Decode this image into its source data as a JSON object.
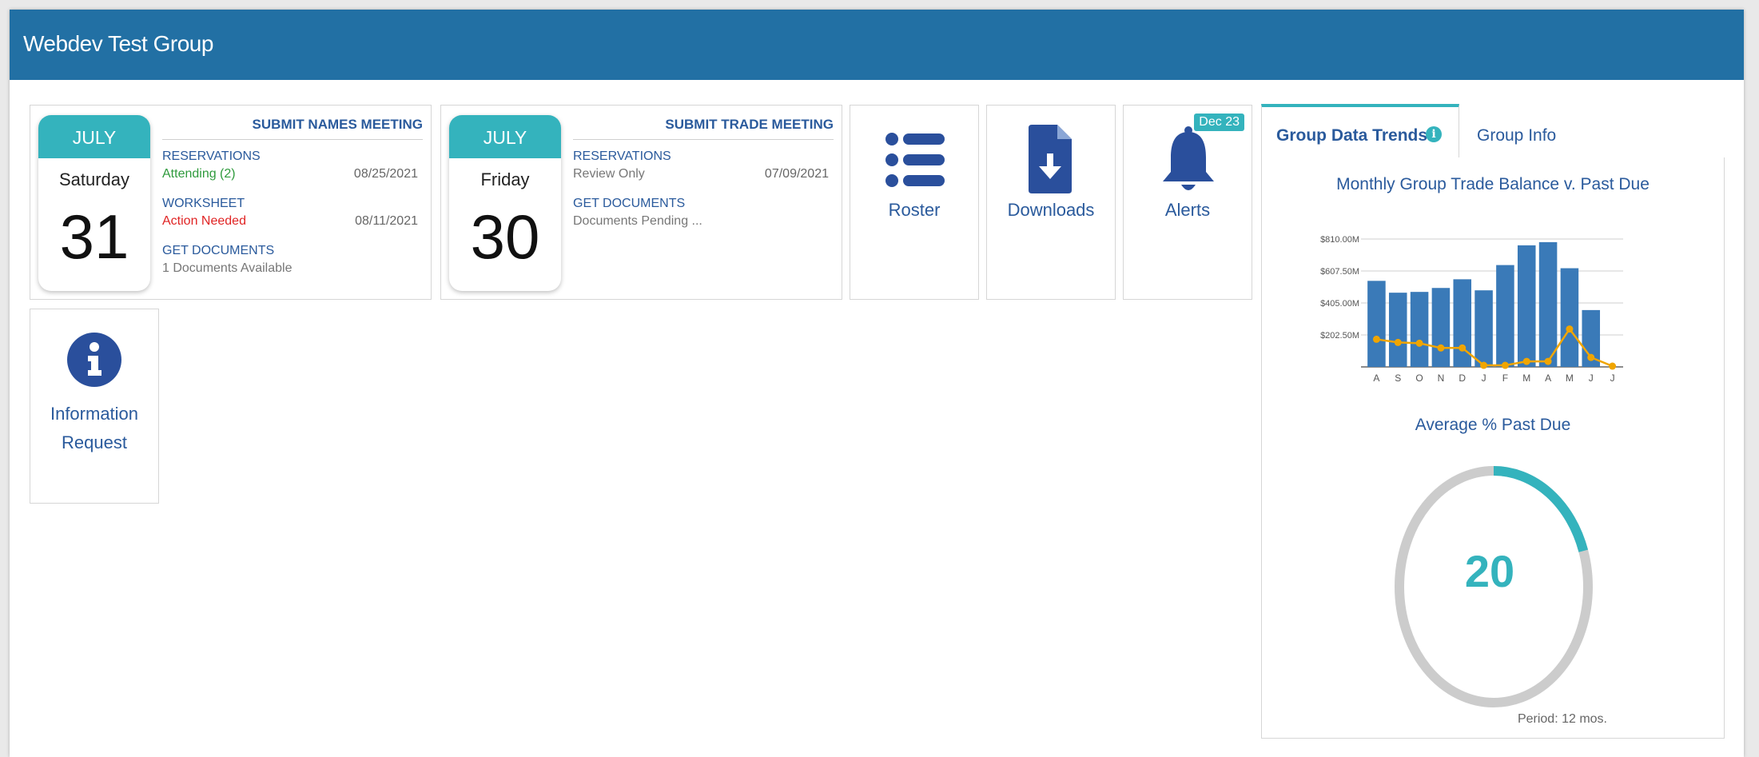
{
  "app": {
    "title": "Webdev Test Group"
  },
  "meetings": [
    {
      "month": "JULY",
      "weekday": "Saturday",
      "day": "31",
      "title": "SUBMIT NAMES MEETING",
      "items": [
        {
          "heading": "RESERVATIONS",
          "status": "Attending (2)",
          "status_color": "#2e9a3c",
          "date": "08/25/2021"
        },
        {
          "heading": "WORKSHEET",
          "status": "Action Needed",
          "status_color": "#e02424",
          "date": "08/11/2021"
        },
        {
          "heading": "GET DOCUMENTS",
          "status": "1 Documents Available",
          "status_color": "#777777",
          "date": ""
        }
      ]
    },
    {
      "month": "JULY",
      "weekday": "Friday",
      "day": "30",
      "title": "SUBMIT TRADE MEETING",
      "items": [
        {
          "heading": "RESERVATIONS",
          "status": "Review Only",
          "status_color": "#777777",
          "date": "07/09/2021"
        },
        {
          "heading": "GET DOCUMENTS",
          "status": "Documents Pending ...",
          "status_color": "#777777",
          "date": ""
        }
      ]
    }
  ],
  "tiles": {
    "roster": {
      "label": "Roster",
      "icon": "list-icon"
    },
    "downloads": {
      "label": "Downloads",
      "icon": "file-download-icon"
    },
    "alerts": {
      "label": "Alerts",
      "icon": "bell-icon",
      "badge": "Dec 23"
    },
    "info_request": {
      "label_line1": "Information",
      "label_line2": "Request",
      "icon": "info-circle-icon"
    }
  },
  "trends": {
    "tab_active": "Group Data Trends",
    "tab_other": "Group Info",
    "chart_title": "Monthly Group Trade Balance v. Past Due",
    "donut_title": "Average % Past Due",
    "donut_value": "20",
    "period": "Period: 12 mos."
  },
  "colors": {
    "accent": "#34b3bd",
    "header": "#2270a4",
    "bar": "#3a7ab8",
    "line": "#f0a500",
    "link": "#2a5a9c"
  },
  "chart_data": [
    {
      "type": "bar",
      "title": "Monthly Group Trade Balance v. Past Due",
      "categories": [
        "A",
        "S",
        "O",
        "N",
        "D",
        "J",
        "F",
        "M",
        "A",
        "M",
        "J",
        "J"
      ],
      "yticks": [
        "$810.00M",
        "$607.50M",
        "$405.00M",
        "$202.50M"
      ],
      "ylim": [
        0,
        810
      ],
      "series": [
        {
          "type": "bar",
          "values": [
            545,
            470,
            475,
            500,
            555,
            485,
            645,
            770,
            790,
            625,
            360,
            0
          ]
        },
        {
          "type": "line",
          "values": [
            175,
            155,
            150,
            120,
            120,
            10,
            10,
            35,
            35,
            240,
            60,
            5
          ]
        }
      ],
      "grid": true,
      "legend": "none"
    },
    {
      "type": "pie",
      "title": "Average % Past Due",
      "values": [
        20,
        80
      ],
      "center_label": "20"
    }
  ]
}
